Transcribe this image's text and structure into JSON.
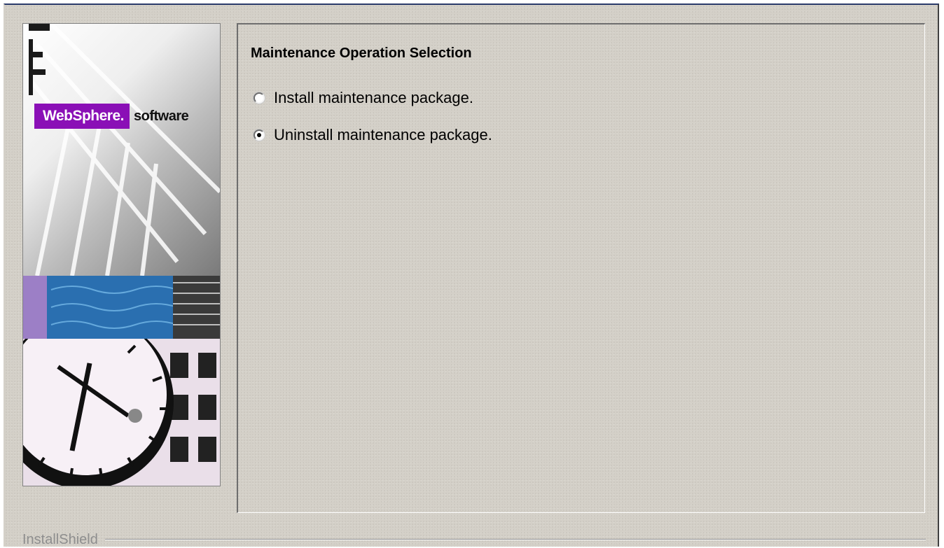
{
  "branding": {
    "logo_box_text": "WebSphere.",
    "logo_suffix_text": "software"
  },
  "main": {
    "title": "Maintenance Operation Selection",
    "options": [
      {
        "label": "Install maintenance package.",
        "selected": false
      },
      {
        "label": "Uninstall maintenance package.",
        "selected": true
      }
    ]
  },
  "footer": {
    "brand": "InstallShield"
  },
  "colors": {
    "window_bg": "#d4d0c8",
    "logo_purple": "#8a0fb6"
  }
}
